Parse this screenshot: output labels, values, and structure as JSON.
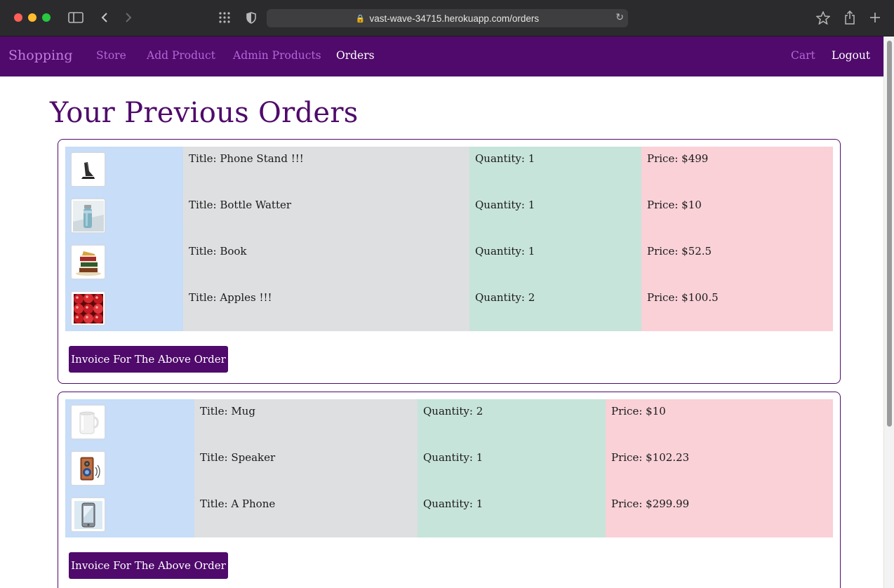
{
  "browser": {
    "url": "vast-wave-34715.herokuapp.com/orders"
  },
  "nav": {
    "brand": "Shopping",
    "links": [
      "Store",
      "Add Product",
      "Admin Products",
      "Orders"
    ],
    "active": "Orders",
    "right": [
      "Cart",
      "Logout"
    ]
  },
  "page": {
    "title": "Your Previous Orders"
  },
  "orders": [
    {
      "invoice_label": "Invoice For The Above Order",
      "items": [
        {
          "title": "Title: Phone Stand !!!",
          "quantity": "Quantity: 1",
          "price": "Price: $499",
          "image": "phone-stand"
        },
        {
          "title": "Title: Bottle Watter",
          "quantity": "Quantity: 1",
          "price": "Price: $10",
          "image": "water-bottle"
        },
        {
          "title": "Title: Book",
          "quantity": "Quantity: 1",
          "price": "Price: $52.5",
          "image": "books"
        },
        {
          "title": "Title: Apples !!!",
          "quantity": "Quantity: 2",
          "price": "Price: $100.5",
          "image": "apples"
        }
      ]
    },
    {
      "invoice_label": "Invoice For The Above Order",
      "items": [
        {
          "title": "Title: Mug",
          "quantity": "Quantity: 2",
          "price": "Price: $10",
          "image": "mug"
        },
        {
          "title": "Title: Speaker",
          "quantity": "Quantity: 1",
          "price": "Price: $102.23",
          "image": "speaker"
        },
        {
          "title": "Title: A Phone",
          "quantity": "Quantity: 1",
          "price": "Price: $299.99",
          "image": "phone"
        }
      ]
    }
  ],
  "colors": {
    "brand_purple": "#4f0a6b",
    "col_image": "#c7ddf8",
    "col_title": "#dedfe1",
    "col_quantity": "#c7e4da",
    "col_price": "#f9d1d7"
  }
}
